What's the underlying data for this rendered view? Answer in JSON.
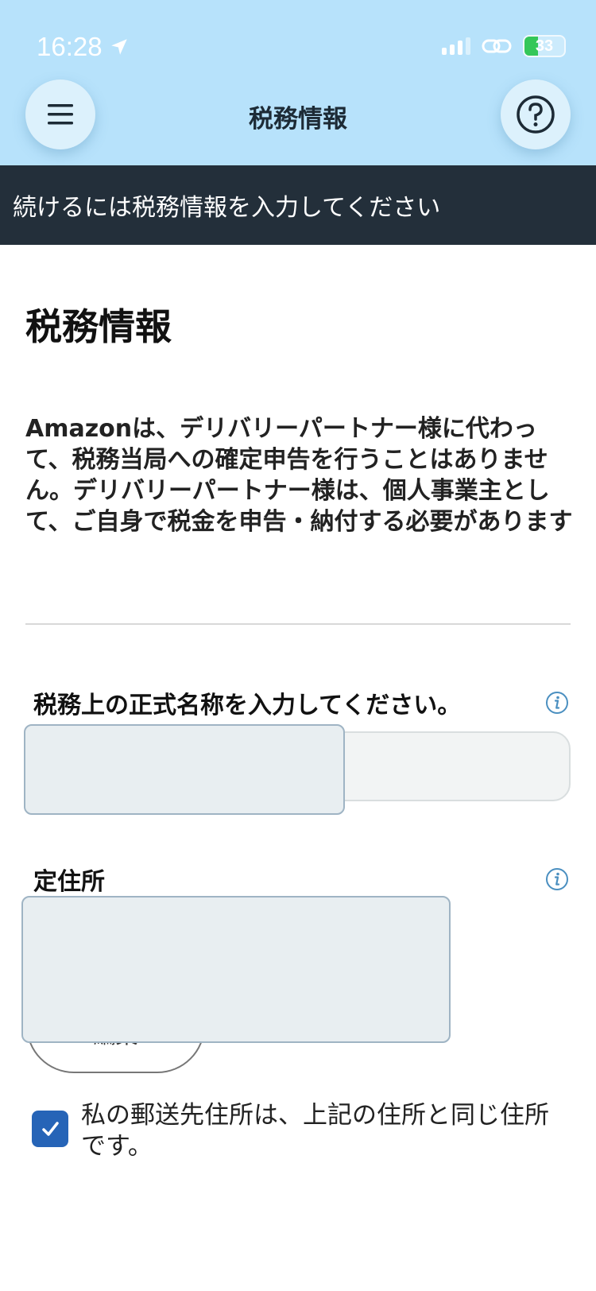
{
  "status_bar": {
    "time": "16:28",
    "battery": "33"
  },
  "header": {
    "title": "税務情報"
  },
  "banner": {
    "text": "続けるには税務情報を入力してください"
  },
  "main": {
    "title": "税務情報",
    "description": "Amazonは、デリバリーパートナー様に代わって、税務当局への確定申告を行うことはありません。デリバリーパートナー様は、個人事業主として、ご自身で税金を申告・納付する必要があります"
  },
  "fields": {
    "name_label": "税務上の正式名称を入力してください。",
    "address_label": "定住所",
    "edit_label": "編集"
  },
  "checkbox": {
    "label": "私の郵送先住所は、上記の住所と同じ住所です。",
    "checked": true
  },
  "colors": {
    "header_bg": "#b7e2fb",
    "banner_bg": "#232f3a",
    "checkbox": "#2664b7"
  }
}
